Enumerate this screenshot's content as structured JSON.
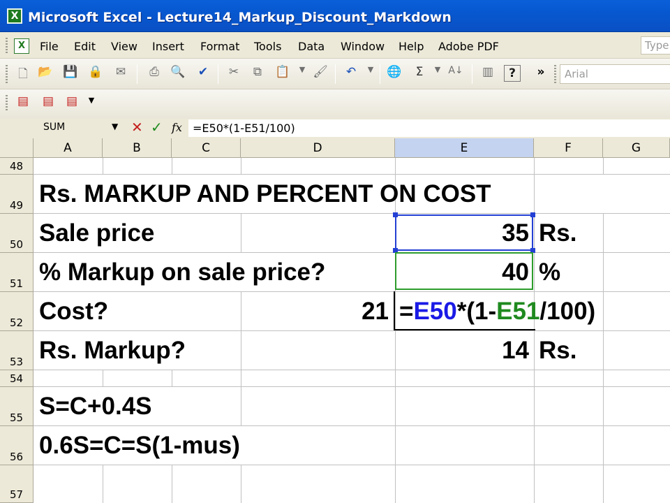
{
  "window": {
    "title": "Microsoft Excel - Lecture14_Markup_Discount_Markdown",
    "app_icon": "excel-icon"
  },
  "menu": {
    "items": [
      "File",
      "Edit",
      "View",
      "Insert",
      "Format",
      "Tools",
      "Data",
      "Window",
      "Help",
      "Adobe PDF"
    ],
    "help_box_text": "Type"
  },
  "toolbar": {
    "font_name": "Arial",
    "buttons": [
      "new-icon",
      "open-icon",
      "save-icon",
      "permission-icon",
      "email-icon",
      "print-icon",
      "print-preview-icon",
      "spelling-icon",
      "cut-icon",
      "copy-icon",
      "paste-icon",
      "format-painter-icon",
      "undo-icon",
      "hyperlink-icon",
      "autosum-icon",
      "sort-icon",
      "chart-wizard-icon",
      "help-icon",
      "overflow-icon"
    ]
  },
  "pdf_toolbar": {
    "buttons": [
      "convert-to-pdf-icon",
      "convert-and-email-icon",
      "pdf-review-icon"
    ]
  },
  "formula_bar": {
    "name_box": "SUM",
    "cancel_symbol": "✕",
    "enter_symbol": "✓",
    "fx_label": "fx",
    "formula": "=E50*(1-E51/100)"
  },
  "sheet": {
    "columns": [
      "A",
      "B",
      "C",
      "D",
      "E",
      "F",
      "G"
    ],
    "active_column": "E",
    "rows": [
      "48",
      "49",
      "50",
      "51",
      "52",
      "53",
      "54",
      "55",
      "56",
      "57"
    ],
    "cells": {
      "A49": "Rs. MARKUP AND PERCENT ON COST",
      "A50": "Sale price",
      "E50": "35",
      "F50": "Rs.",
      "A51": "% Markup on sale price?",
      "E51": "40",
      "F51": "%",
      "A52": "Cost?",
      "D52": "21",
      "A53": "Rs. Markup?",
      "E53": "14",
      "F53": "Rs.",
      "A55": "S=C+0.4S",
      "A56": "0.6S=C=S(1-mus)"
    },
    "edit_cell": {
      "ref": "E52",
      "parts": {
        "eq": "=",
        "ref1": "E50",
        "op1": "*(1-",
        "ref2": "E51",
        "op2": "/100)"
      },
      "ref1_color": "#1a1ae6",
      "ref2_color": "#1f8a1f"
    }
  }
}
